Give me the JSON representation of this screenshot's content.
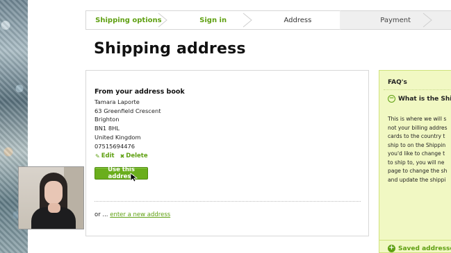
{
  "steps": [
    {
      "label": "Shipping options",
      "state": "done"
    },
    {
      "label": "Sign in",
      "state": "done"
    },
    {
      "label": "Address",
      "state": "current"
    },
    {
      "label": "Payment",
      "state": "upcoming"
    }
  ],
  "page_title": "Shipping address",
  "address_book": {
    "heading": "From your address book",
    "lines": [
      "Tamara Laporte",
      "63 Greenfield Crescent",
      "Brighton",
      "BN1 8HL",
      "United Kingdom",
      "07515694476"
    ],
    "edit_label": "Edit",
    "delete_label": "Delete",
    "use_button": "Use this address"
  },
  "or_text": "or ...",
  "new_address_link": "enter a new address",
  "faq": {
    "title": "FAQ's",
    "question": "What is the Ship",
    "answer_lines": [
      "This is where we will s",
      "not your billing addres",
      "cards to the country t",
      "ship to on the Shippin",
      "you'd like to change t",
      "to ship to, you will ne",
      "page to change the sh",
      "and update the shippi"
    ],
    "saved_addresses": "Saved addresses"
  },
  "colors": {
    "accent_green": "#5fa012",
    "button_green": "#6aae1c",
    "faq_bg": "#f1f8c3"
  },
  "icons": {
    "edit": "pencil-icon",
    "delete": "cross-icon",
    "faq_toggle": "minus-circle-icon",
    "saved": "plus-circle-icon",
    "cursor": "mouse-pointer-icon"
  }
}
